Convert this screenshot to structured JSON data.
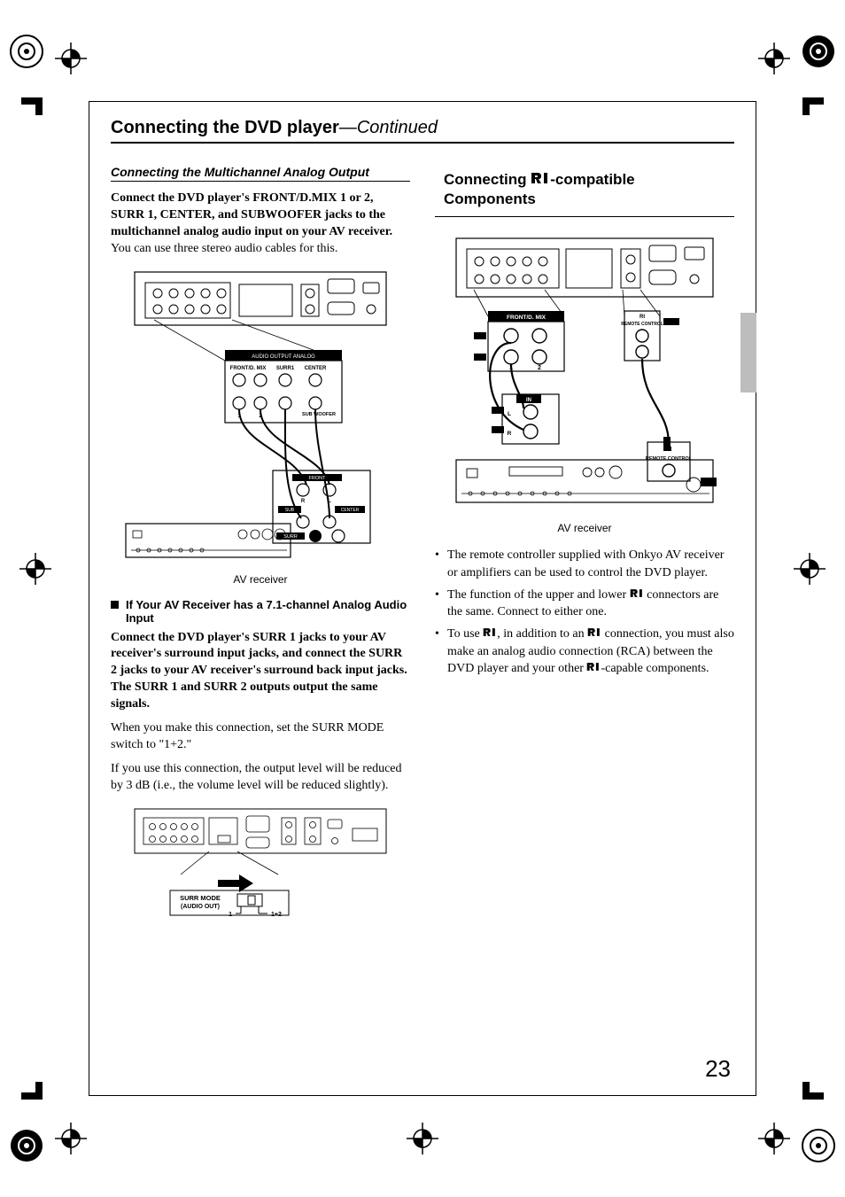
{
  "page": {
    "number": "23",
    "title_main": "Connecting the DVD player",
    "title_cont": "—Continued"
  },
  "left": {
    "subhead": "Connecting the Multichannel Analog Output",
    "para1_bold": "Connect the DVD player's FRONT/D.MIX 1 or 2, SURR 1, CENTER, and SUBWOOFER jacks to the multichannel analog audio input on your AV receiver.",
    "para1_tail": " You can use three stereo audio cables for this.",
    "fig1_caption": "AV receiver",
    "square_head": "If Your AV Receiver has a 7.1-channel Analog Audio Input",
    "para2_bold": "Connect the DVD player's SURR 1 jacks to your AV receiver's surround input jacks, and connect the SURR 2 jacks to your AV receiver's surround back input jacks. The SURR 1 and SURR 2 outputs output the same signals.",
    "para3": "When you make this connection, set the SURR MODE switch to \"1+2.\"",
    "para4": "If you use this connection, the output level will be reduced by 3 dB (i.e., the volume level will be reduced slightly).",
    "fig1_labels": {
      "audio_output_analog": "AUDIO OUTPUT ANALOG",
      "front_dmix": "FRONT/D. MIX",
      "surr1": "SURR1",
      "center": "CENTER",
      "sub_woofer": "SUB WOOFER",
      "one": "1",
      "two": "2",
      "front": "FRONT",
      "R": "R",
      "L": "L",
      "sub": "SUB",
      "center2": "CENTER",
      "surr": "SURR"
    },
    "fig2_labels": {
      "surr_mode": "SURR MODE",
      "audio_out": "(AUDIO OUT)",
      "one": "1",
      "one_plus_two": "1+2"
    }
  },
  "right": {
    "boxhead_pre": "Connecting ",
    "boxhead_post": "-compatible Components",
    "fig_caption": "AV receiver",
    "fig_labels": {
      "front_dmix": "FRONT/D. MIX",
      "one": "1",
      "two": "2",
      "remote_control": "REMOTE CONTROL",
      "in": "IN",
      "L": "L",
      "R": "R"
    },
    "b1": {
      "text": "The remote controller supplied with Onkyo AV receiver or amplifiers can be used to control the DVD player."
    },
    "b2": {
      "pre": "The function of the upper and lower ",
      "post": " connectors are the same. Connect to either one."
    },
    "b3": {
      "pre": "To use ",
      "mid1": ", in addition to an ",
      "mid2": " connection, you must also make an analog audio connection (RCA) between the DVD player and your other ",
      "post": "-capable components."
    }
  }
}
